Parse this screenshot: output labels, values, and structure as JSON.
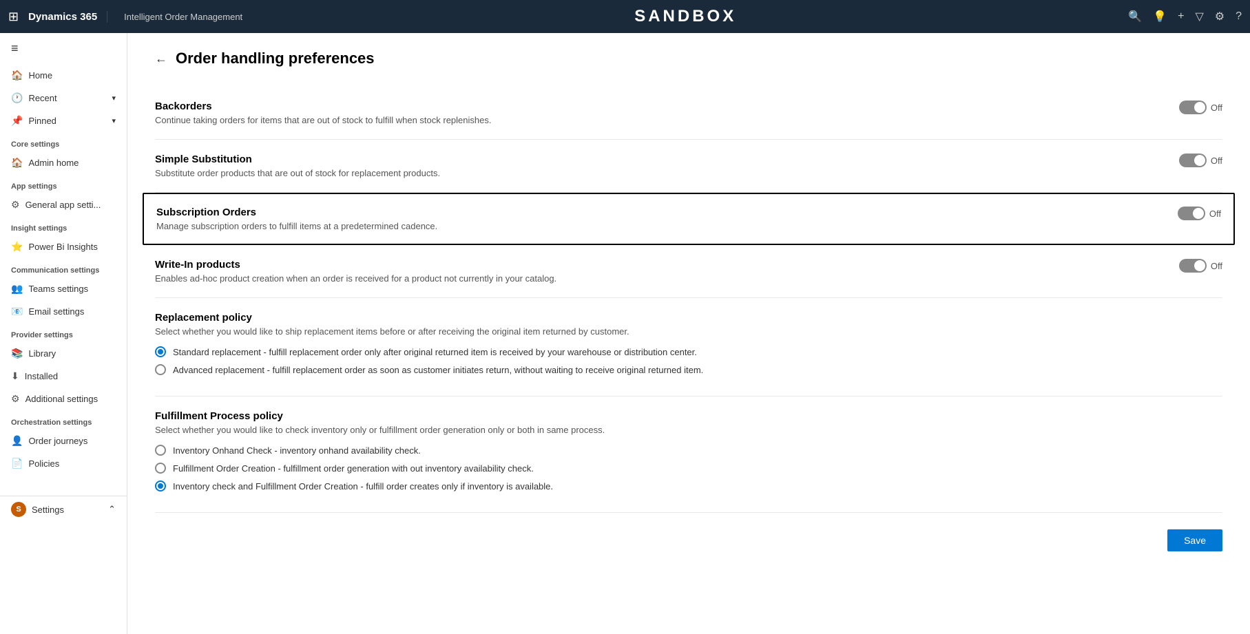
{
  "topbar": {
    "waffle_icon": "⊞",
    "app_name_primary": "Dynamics 365",
    "app_name_secondary": "Intelligent Order Management",
    "sandbox_label": "SANDBOX",
    "icons": [
      "🔍",
      "💡",
      "+",
      "▽",
      "⚙",
      "?"
    ]
  },
  "sidebar": {
    "hamburger": "≡",
    "nav_items": [
      {
        "label": "Home",
        "icon": "🏠"
      },
      {
        "label": "Recent",
        "icon": "🕐",
        "has_chevron": true
      },
      {
        "label": "Pinned",
        "icon": "📌",
        "has_chevron": true
      }
    ],
    "sections": [
      {
        "header": "Core settings",
        "items": [
          {
            "label": "Admin home",
            "icon": "🏠"
          }
        ]
      },
      {
        "header": "App settings",
        "items": [
          {
            "label": "General app setti...",
            "icon": "⚙"
          }
        ]
      },
      {
        "header": "Insight settings",
        "items": [
          {
            "label": "Power Bi Insights",
            "icon": "⭐"
          }
        ]
      },
      {
        "header": "Communication settings",
        "items": [
          {
            "label": "Teams settings",
            "icon": "👥"
          },
          {
            "label": "Email settings",
            "icon": "📧"
          }
        ]
      },
      {
        "header": "Provider settings",
        "items": [
          {
            "label": "Library",
            "icon": "📚"
          },
          {
            "label": "Installed",
            "icon": "⬇"
          },
          {
            "label": "Additional settings",
            "icon": "⚙"
          }
        ]
      },
      {
        "header": "Orchestration settings",
        "items": [
          {
            "label": "Order journeys",
            "icon": "👤"
          },
          {
            "label": "Policies",
            "icon": "📄"
          }
        ]
      }
    ],
    "bottom_item": {
      "avatar_label": "S",
      "label": "Settings"
    }
  },
  "page": {
    "back_icon": "←",
    "title": "Order handling preferences",
    "settings": [
      {
        "id": "backorders",
        "title": "Backorders",
        "description": "Continue taking orders for items that are out of stock to fulfill when stock replenishes.",
        "toggle_state": "Off",
        "highlighted": false
      },
      {
        "id": "simple-substitution",
        "title": "Simple Substitution",
        "description": "Substitute order products that are out of stock for replacement products.",
        "toggle_state": "Off",
        "highlighted": false
      },
      {
        "id": "subscription-orders",
        "title": "Subscription Orders",
        "description": "Manage subscription orders to fulfill items at a predetermined cadence.",
        "toggle_state": "Off",
        "highlighted": true
      },
      {
        "id": "write-in-products",
        "title": "Write-In products",
        "description": "Enables ad-hoc product creation when an order is received for a product not currently in your catalog.",
        "toggle_state": "Off",
        "highlighted": false
      }
    ],
    "replacement_policy": {
      "title": "Replacement policy",
      "description": "Select whether you would like to ship replacement items before or after receiving the original item returned by customer.",
      "options": [
        {
          "label": "Standard replacement - fulfill replacement order only after original returned item is received by your warehouse or distribution center.",
          "selected": true
        },
        {
          "label": "Advanced replacement - fulfill replacement order as soon as customer initiates return, without waiting to receive original returned item.",
          "selected": false
        }
      ]
    },
    "fulfillment_policy": {
      "title": "Fulfillment Process policy",
      "description": "Select whether you would like to check inventory only or fulfillment order generation only or both in same process.",
      "options": [
        {
          "label": "Inventory Onhand Check - inventory onhand availability check.",
          "selected": false
        },
        {
          "label": "Fulfillment Order Creation - fulfillment order generation with out inventory availability check.",
          "selected": false
        },
        {
          "label": "Inventory check and Fulfillment Order Creation - fulfill order creates only if inventory is available.",
          "selected": true
        }
      ]
    },
    "save_button": "Save"
  }
}
